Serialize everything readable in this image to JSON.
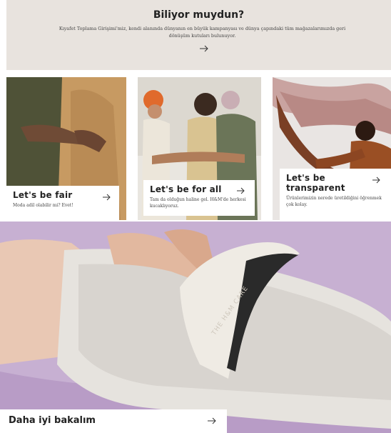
{
  "banner": {
    "title": "Biliyor muydun?",
    "text": "Kıyafet Toplama Girişimi'miz, kendi alanında dünyanın en büyük kampanyası ve dünya çapındaki tüm mağazalarımızda geri dönüşüm kutuları bulunuyor.",
    "arrow_icon": "arrow-right-icon"
  },
  "cards": [
    {
      "title": "Let's be fair",
      "description": "Moda adil olabilir mi? Evet!",
      "arrow_icon": "arrow-right-icon"
    },
    {
      "title": "Let's be for all",
      "description": "Tam da olduğun haline gel. H&M'de herkesi kucaklıyoruz.",
      "arrow_icon": "arrow-right-icon"
    },
    {
      "title": "Let's be transparent",
      "description": "Ürünlerimizin nerede üretildiğini öğrenmek çok kolay.",
      "arrow_icon": "arrow-right-icon"
    }
  ],
  "hero": {
    "title": "Daha iyi bakalım",
    "comb_text": "THE H&M CARE",
    "arrow_icon": "arrow-right-icon"
  }
}
